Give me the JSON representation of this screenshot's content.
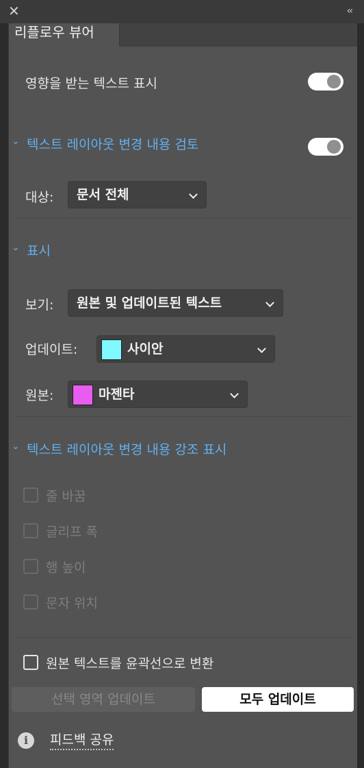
{
  "window": {
    "close_glyph": "✕",
    "collapse_glyph": "‹‹"
  },
  "panel": {
    "tab_title": "리플로우 뷰어"
  },
  "show_affected": {
    "label": "영향을 받는 텍스트 표시",
    "enabled": true
  },
  "review_section": {
    "title": "텍스트 레이아웃 변경 내용 검토",
    "enabled": true,
    "target_label": "대상:",
    "target_value": "문서 전체"
  },
  "display_section": {
    "title": "표시",
    "view_label": "보기:",
    "view_value": "원본 및 업데이트된 텍스트",
    "updated_label": "업데이트:",
    "updated_color_name": "사이안",
    "updated_color": "#80f8ff",
    "original_label": "원본:",
    "original_color_name": "마젠타",
    "original_color": "#e85cf0"
  },
  "highlight_section": {
    "title": "텍스트 레이아웃 변경 내용 강조 표시",
    "options": [
      {
        "label": "줄 바꿈",
        "checked": false
      },
      {
        "label": "글리프 폭",
        "checked": false
      },
      {
        "label": "행 높이",
        "checked": false
      },
      {
        "label": "문자 위치",
        "checked": false
      }
    ]
  },
  "convert_outline": {
    "label": "원본 텍스트를 윤곽선으로 변환",
    "checked": false
  },
  "buttons": {
    "update_selection": "선택 영역 업데이트",
    "update_all": "모두 업데이트"
  },
  "footer": {
    "info_glyph": "i",
    "feedback_label": "피드백 공유"
  },
  "colors": {
    "panel_bg": "#535353",
    "accent_blue": "#62b0f0"
  }
}
